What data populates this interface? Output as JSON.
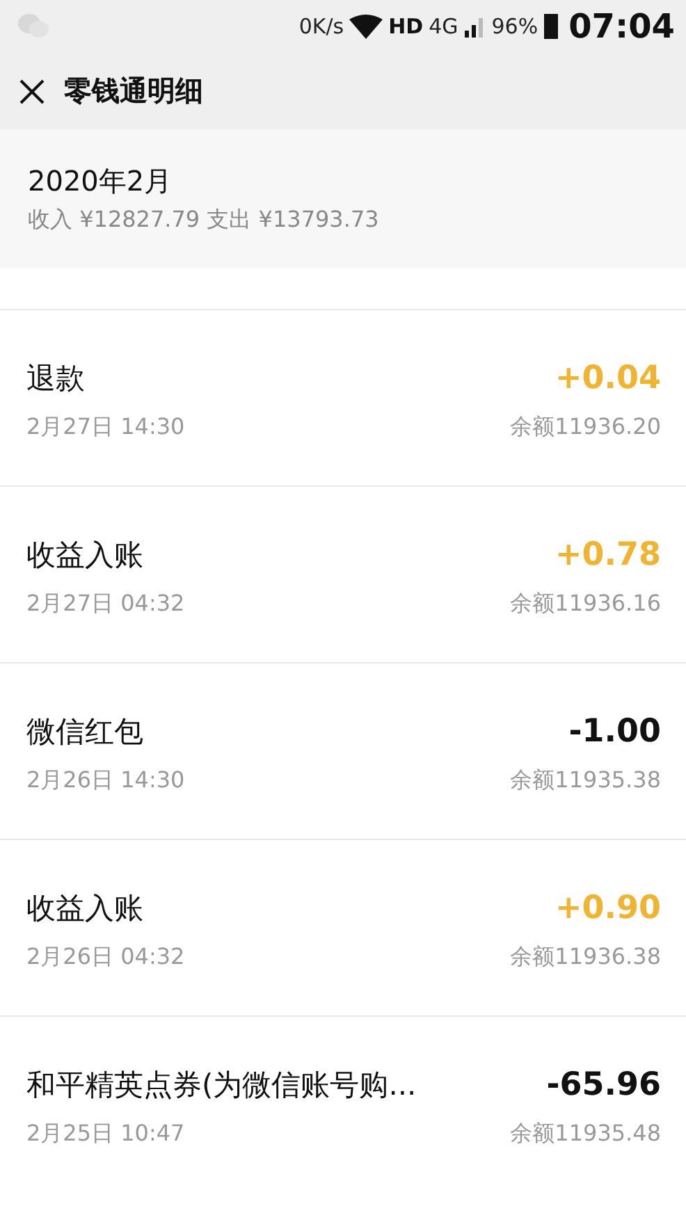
{
  "status_bar": {
    "speed": "0K/s",
    "hd": "HD",
    "network": "4G",
    "battery": "96%",
    "time": "07:04"
  },
  "header": {
    "title": "零钱通明细"
  },
  "month": {
    "title": "2020年2月",
    "summary": "收入 ¥12827.79 支出 ¥13793.73"
  },
  "transactions": [
    {
      "title": "退款",
      "time": "2月27日 14:30",
      "amount": "+0.04",
      "kind": "income",
      "balance": "余额11936.20"
    },
    {
      "title": "收益入账",
      "time": "2月27日 04:32",
      "amount": "+0.78",
      "kind": "income",
      "balance": "余额11936.16"
    },
    {
      "title": "微信红包",
      "time": "2月26日 14:30",
      "amount": "-1.00",
      "kind": "expense",
      "balance": "余额11935.38"
    },
    {
      "title": "收益入账",
      "time": "2月26日 04:32",
      "amount": "+0.90",
      "kind": "income",
      "balance": "余额11936.38"
    },
    {
      "title": "和平精英点券(为微信账号购...",
      "time": "2月25日 10:47",
      "amount": "-65.96",
      "kind": "expense",
      "balance": "余额11935.48"
    }
  ]
}
